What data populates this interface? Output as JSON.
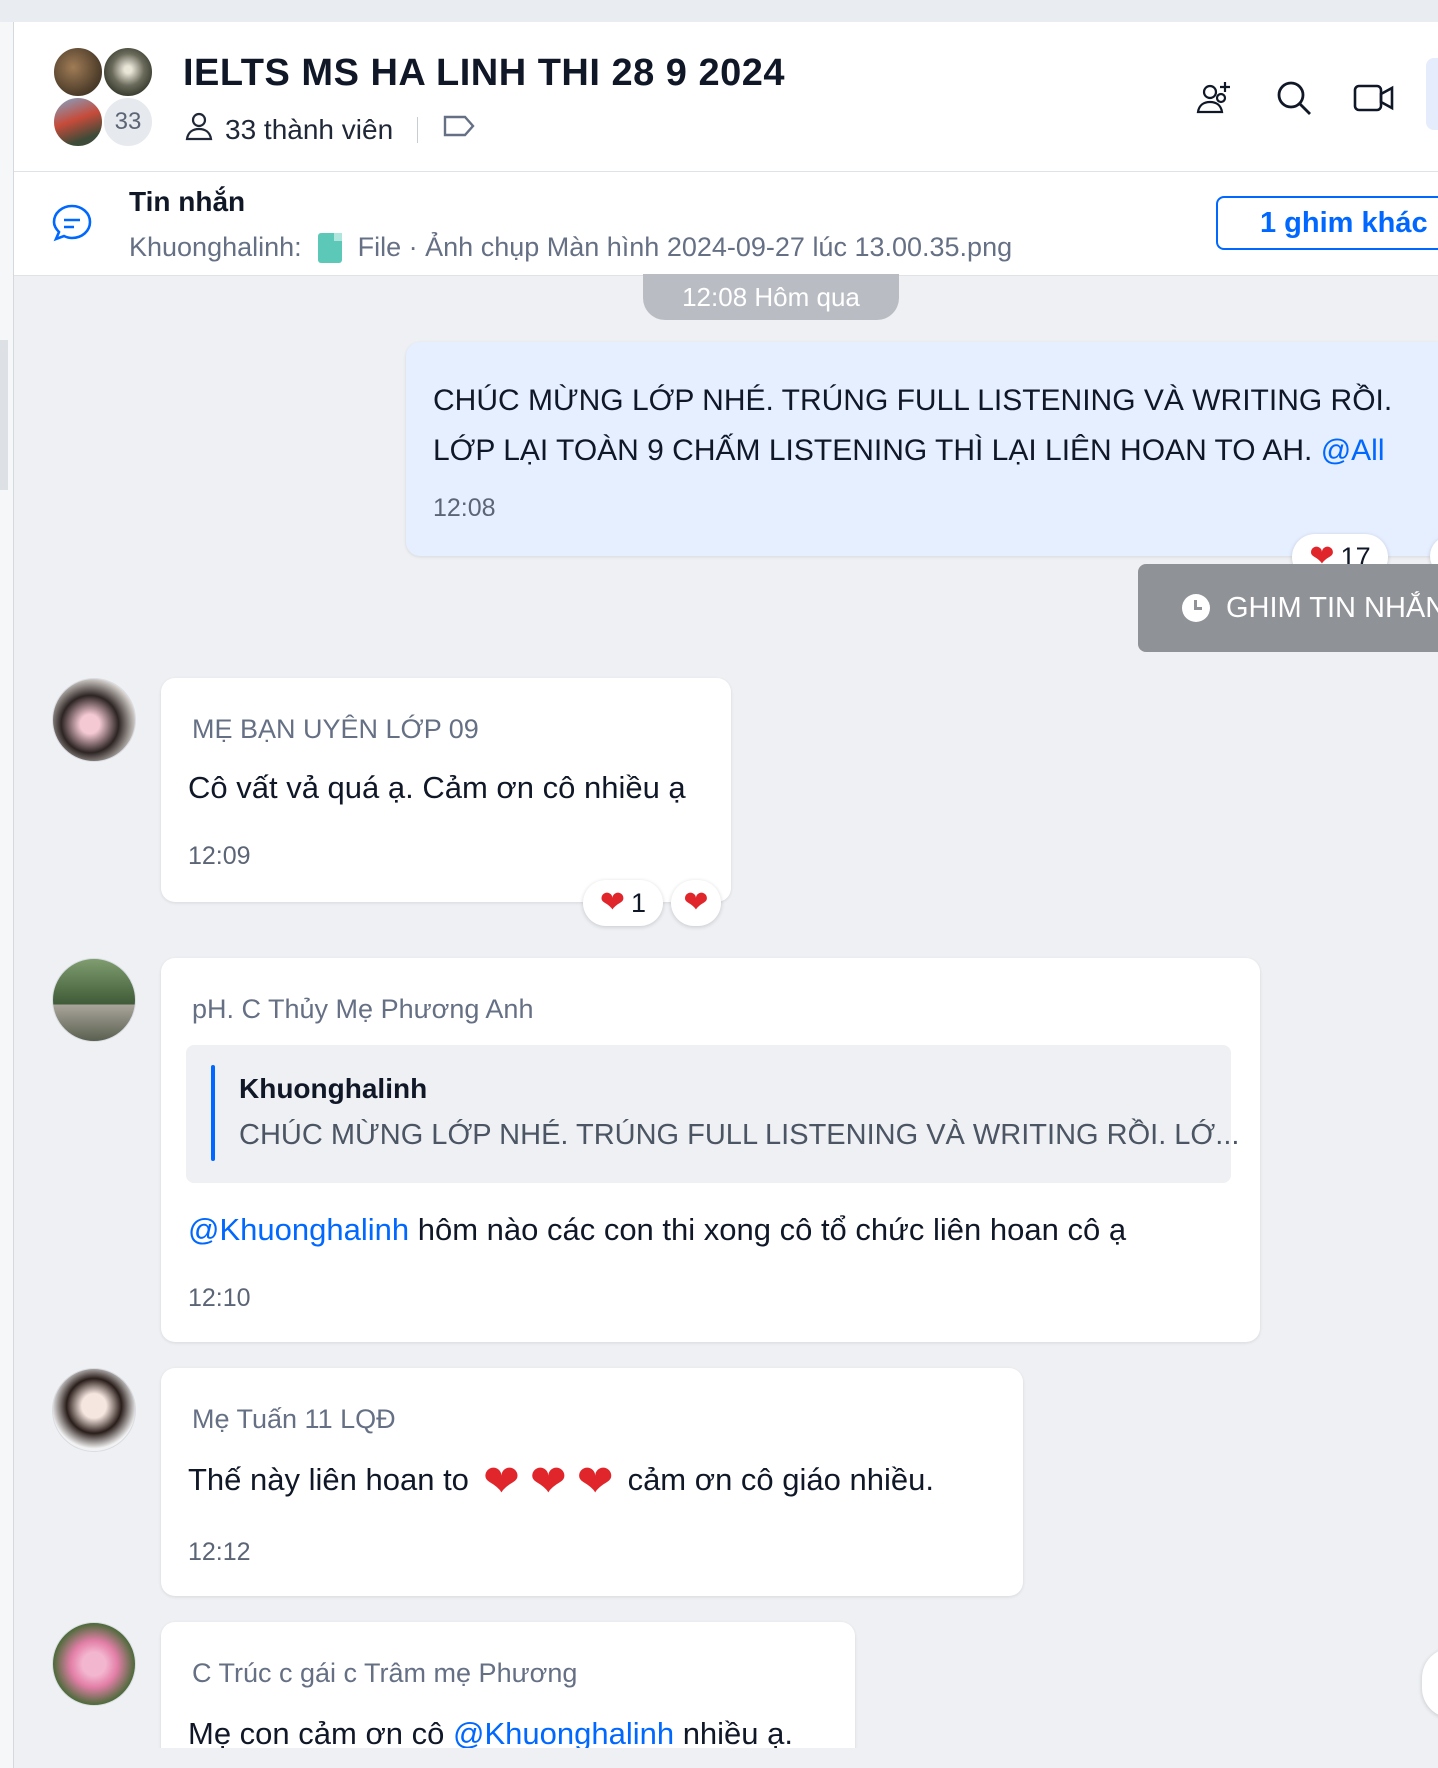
{
  "header": {
    "title": "IELTS MS HA LINH THI 28 9 2024",
    "member_avatar_count": "33",
    "members_label": "33 thành viên",
    "icons": [
      "add-member-icon",
      "search-icon",
      "video-call-icon"
    ]
  },
  "pinned": {
    "title": "Tin nhắn",
    "sender": "Khuonghalinh:",
    "file_label": "File · Ảnh chụp Màn hình 2024-09-27 lúc 13.00.35.png",
    "more_pins_label": "1 ghim khác"
  },
  "chat": {
    "date_chip": "12:08 Hôm qua",
    "messages": [
      {
        "line1": "CHÚC MỪNG LỚP NHÉ. TRÚNG FULL LISTENING VÀ WRITING RỒI.",
        "line2": "LỚP LẠI TOÀN 9 CHẤM LISTENING THÌ LẠI LIÊN HOAN TO AH.",
        "mention": "@All",
        "time": "12:08",
        "reaction_count": "17"
      },
      {
        "sender": "MẸ BẠN UYÊN LỚP 09",
        "text": "Cô vất vả quá ạ. Cảm ơn cô nhiều ạ",
        "time": "12:09",
        "reaction_count": "1"
      },
      {
        "sender": "pH. C Thủy Mẹ Phương Anh",
        "quote_name": "Khuonghalinh",
        "quote_text": "CHÚC MỪNG LỚP NHÉ. TRÚNG FULL LISTENING VÀ WRITING RỒI. LỚ...",
        "mention": "@Khuonghalinh",
        "text": " hôm nào các con thi xong cô tổ chức liên hoan cô ạ",
        "time": "12:10"
      },
      {
        "sender": "Mẹ Tuấn 11 LQĐ",
        "text_before": "Thế này liên hoan to",
        "text_after": "cảm ơn cô giáo nhiều.",
        "time": "12:12"
      },
      {
        "sender": "C Trúc c gái c Trâm mẹ Phương",
        "text_before": "Mẹ con cảm ơn cô ",
        "mention": "@Khuonghalinh",
        "text_after": " nhiều ạ."
      }
    ]
  },
  "toast": {
    "label": "GHIM TIN NHẮN"
  },
  "colors": {
    "accent": "#0068ff",
    "my_bubble": "#e5efff",
    "heart": "#e0262b"
  }
}
